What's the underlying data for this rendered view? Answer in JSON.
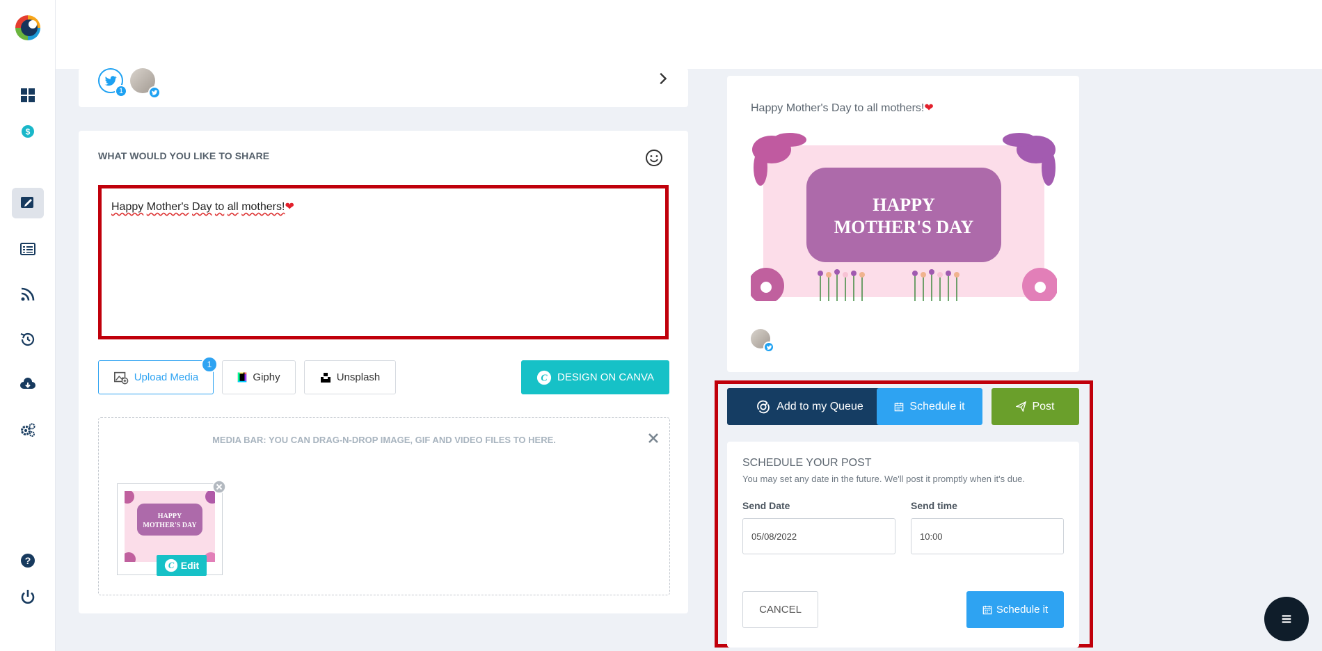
{
  "sidebar": {
    "items": [
      {
        "name": "dashboard-icon"
      },
      {
        "name": "billing-icon"
      },
      {
        "name": "compose-icon",
        "active": true
      },
      {
        "name": "posts-list-icon"
      },
      {
        "name": "rss-feed-icon"
      },
      {
        "name": "history-icon"
      },
      {
        "name": "cloud-download-icon"
      },
      {
        "name": "settings-icon"
      },
      {
        "name": "help-icon"
      },
      {
        "name": "power-icon"
      }
    ]
  },
  "accounts": {
    "twitter_count": "1"
  },
  "composer": {
    "title": "WHAT WOULD YOU LIKE TO SHARE",
    "text_part1": "Happy",
    "text_part2": "Mother's",
    "text_part3": "Day",
    "text_part4": "to",
    "text_part5": "all",
    "text_part6": "mothers!",
    "heart": "❤",
    "upload_label": "Upload Media",
    "upload_count": "1",
    "giphy_label": "Giphy",
    "unsplash_label": "Unsplash",
    "canva_label": "DESIGN ON CANVA",
    "mediabar_text": "MEDIA BAR: YOU CAN DRAG-N-DROP IMAGE, GIF AND VIDEO FILES TO HERE.",
    "edit_label": "Edit"
  },
  "preview": {
    "text": "Happy Mother's Day to all mothers!",
    "heart": "❤",
    "image_text_line1": "HAPPY",
    "image_text_line2": "MOTHER'S DAY"
  },
  "actions": {
    "queue_label": "Add to my Queue",
    "schedule_label": "Schedule it",
    "post_label": "Post"
  },
  "schedule": {
    "title": "SCHEDULE YOUR POST",
    "subtitle": "You may set any date in the future. We'll post it promptly when it's due.",
    "date_label": "Send Date",
    "date_value": "05/08/2022",
    "time_label": "Send time",
    "time_value": "10:00",
    "cancel_label": "CANCEL",
    "submit_label": "Schedule it"
  },
  "colors": {
    "accent_blue": "#2ea3f2",
    "navy": "#153d63",
    "green": "#6a9f2b",
    "canva_teal": "#16c1c7",
    "highlight_red": "#c0000b"
  }
}
